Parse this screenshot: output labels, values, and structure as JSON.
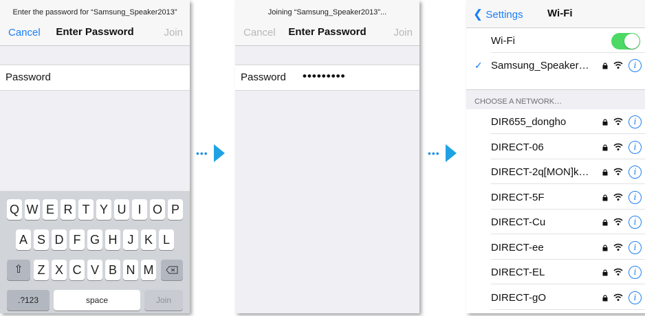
{
  "screen1": {
    "prompt": "Enter the password for “Samsung_Speaker2013”",
    "cancel": "Cancel",
    "title": "Enter Password",
    "join": "Join",
    "password_label": "Password",
    "keyboard": {
      "row1": [
        "Q",
        "W",
        "E",
        "R",
        "T",
        "Y",
        "U",
        "I",
        "O",
        "P"
      ],
      "row2": [
        "A",
        "S",
        "D",
        "F",
        "G",
        "H",
        "J",
        "K",
        "L"
      ],
      "row3": [
        "Z",
        "X",
        "C",
        "V",
        "B",
        "N",
        "M"
      ],
      "numbers": ".?123",
      "space": "space",
      "join": "Join"
    }
  },
  "screen2": {
    "prompt": "Joining “Samsung_Speaker2013”...",
    "cancel": "Cancel",
    "title": "Enter Password",
    "join": "Join",
    "password_label": "Password",
    "password_value": "•••••••••"
  },
  "screen3": {
    "back": "Settings",
    "title": "Wi-Fi",
    "wifi_label": "Wi-Fi",
    "wifi_on": true,
    "connected": "Samsung_Speaker…",
    "section": "CHOOSE A NETWORK…",
    "networks": [
      "DIR655_dongho",
      "DIRECT-06",
      "DIRECT-2q[MON]k…",
      "DIRECT-5F",
      "DIRECT-Cu",
      "DIRECT-ee",
      "DIRECT-EL",
      "DIRECT-gO"
    ]
  },
  "colors": {
    "accent": "#1a7ef5",
    "toggle": "#4cd964",
    "arrow": "#1fa2e3"
  }
}
